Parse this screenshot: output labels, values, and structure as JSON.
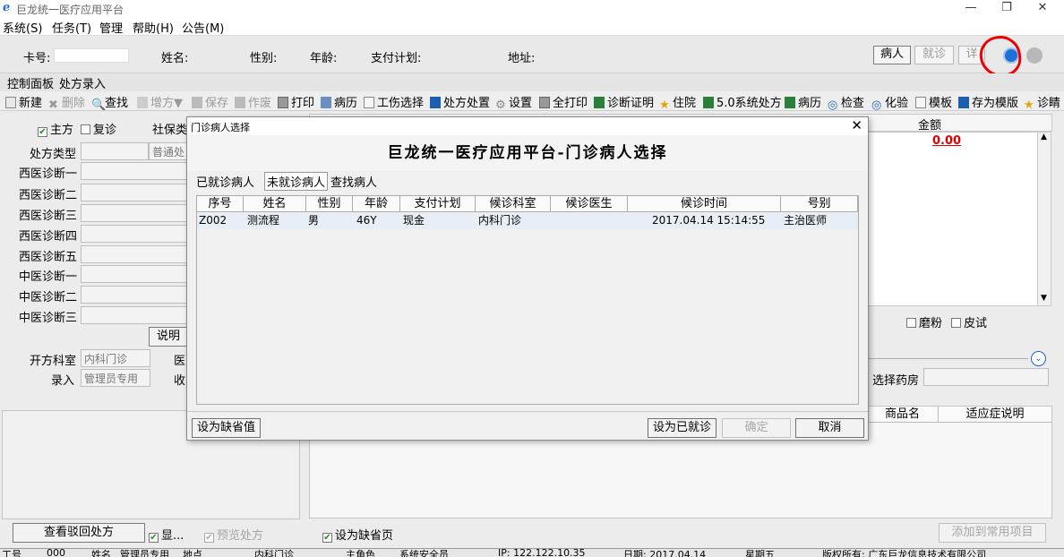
{
  "window": {
    "title": "巨龙统一医疗应用平台",
    "controls": [
      "—",
      "❐",
      "✕"
    ]
  },
  "menu": [
    {
      "label": "系统(S)"
    },
    {
      "label": "任务(T)"
    },
    {
      "label": "管理"
    },
    {
      "label": "帮助(H)"
    },
    {
      "label": "公告(M)"
    }
  ],
  "patient_bar": {
    "card_label": "卡号:",
    "card_value": "",
    "name_label": "姓名:",
    "sex_label": "性别:",
    "age_label": "年龄:",
    "payment_label": "支付计划:",
    "address_label": "地址:",
    "patient_button": "病人",
    "visit_button": "就诊",
    "detail_button": "详"
  },
  "tabs": [
    {
      "label": "控制面板"
    },
    {
      "label": "处方录入"
    }
  ],
  "toolbar": {
    "new": "新建",
    "delete": "删除",
    "find": "查找",
    "add_rx": "增方▼",
    "save": "保存",
    "void": "作废",
    "print": "打印",
    "record": "病历",
    "injury": "工伤选择",
    "rx_handle": "处方处置",
    "settings": "设置",
    "print_all": "全打印",
    "diag_cert": "诊断证明",
    "hospitalize": "住院",
    "sys50": "5.0系统处方",
    "record2": "病历",
    "exam": "检查",
    "lab": "化验",
    "template": "模板",
    "save_template": "存为模版",
    "diag": "诊睛"
  },
  "left_form": {
    "main_rx": "主方",
    "repeat_visit": "复诊",
    "social_security": "社保类",
    "rx_type_label": "处方类型",
    "rx_type_value": "普通处",
    "diagnoses": [
      "西医诊断一",
      "西医诊断二",
      "西医诊断三",
      "西医诊断四",
      "西医诊断五",
      "中医诊断一",
      "中医诊断二",
      "中医诊断三"
    ],
    "explain_button": "说明",
    "dept_label": "开方科室",
    "dept_value": "内科门诊",
    "doctor_label": "医",
    "entry_label": "录入",
    "entry_value": "管理员专用",
    "receive_label": "收",
    "query_button": "查看驳回处方",
    "show_check": "显...",
    "preview_check": "预览处方"
  },
  "right_area": {
    "amount_header": "金额",
    "amount_value": "0.00",
    "grind": "磨粉",
    "skin_test": "皮试",
    "pharmacy_label": "选择药房",
    "product_header": "商品名",
    "indication_header": "适应症说明",
    "default_page": "设为缺省页",
    "add_common": "添加到常用项目"
  },
  "dialog": {
    "title": "门诊病人选择",
    "banner": "巨龙统一医疗应用平台-门诊病人选择",
    "close": "✕",
    "tabs": [
      {
        "label": "已就诊病人"
      },
      {
        "label": "未就诊病人"
      },
      {
        "label": "查找病人"
      }
    ],
    "columns": [
      "序号",
      "姓名",
      "性别",
      "年龄",
      "支付计划",
      "候诊科室",
      "候诊医生",
      "候诊时间",
      "号别"
    ],
    "rows": [
      {
        "id": "Z002",
        "name": "测流程",
        "sex": "男",
        "age": "46Y",
        "payment": "现金",
        "dept": "内科门诊",
        "doctor": "",
        "time": "2017.04.14 15:14:55",
        "type": "主治医师"
      }
    ],
    "buttons": {
      "set_default": "设为缺省值",
      "set_visited": "设为已就诊",
      "confirm": "确定",
      "cancel": "取消"
    }
  },
  "statusbar": {
    "items": [
      "工号",
      "000",
      "姓名",
      "管理员专用",
      "地点",
      "内科门诊",
      "主角色",
      "系统安全员",
      "IP: 122.122.10.35",
      "日期: 2017.04.14",
      "星期五",
      "版权所有: 广东巨龙信息技术有限公司"
    ]
  }
}
